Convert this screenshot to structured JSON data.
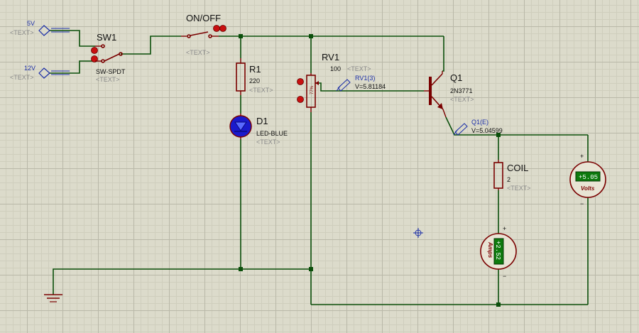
{
  "terminals": [
    {
      "label": "5V",
      "placeholder": "<TEXT>"
    },
    {
      "label": "12V",
      "placeholder": "<TEXT>"
    }
  ],
  "sw1": {
    "ref": "SW1",
    "value": "SW-SPDT",
    "placeholder": "<TEXT>"
  },
  "onoff": {
    "ref": "ON/OFF",
    "placeholder": "<TEXT>"
  },
  "r1": {
    "ref": "R1",
    "value": "220",
    "placeholder": "<TEXT>"
  },
  "d1": {
    "ref": "D1",
    "value": "LED-BLUE",
    "placeholder": "<TEXT>"
  },
  "rv1": {
    "ref": "RV1",
    "value": "100",
    "placeholder": "<TEXT>",
    "wiper": "77%"
  },
  "q1": {
    "ref": "Q1",
    "value": "2N3771",
    "placeholder": "<TEXT>"
  },
  "coil": {
    "ref": "COIL",
    "value": "2",
    "placeholder": "<TEXT>"
  },
  "probes": [
    {
      "name": "RV1(3)",
      "reading": "V=5.81184"
    },
    {
      "name": "Q1(E)",
      "reading": "V=5.04599"
    }
  ],
  "voltmeter": {
    "display": "+5.05",
    "label": "Volts",
    "plus": "+",
    "minus": "−"
  },
  "ammeter": {
    "display": "+2.52",
    "label": "Amps",
    "plus": "+",
    "minus": "−"
  },
  "colors": {
    "wire": "#0b4f0b",
    "part": "#7a0000",
    "led": "#1a1acc",
    "lcd_bg": "#0d7a0d"
  }
}
